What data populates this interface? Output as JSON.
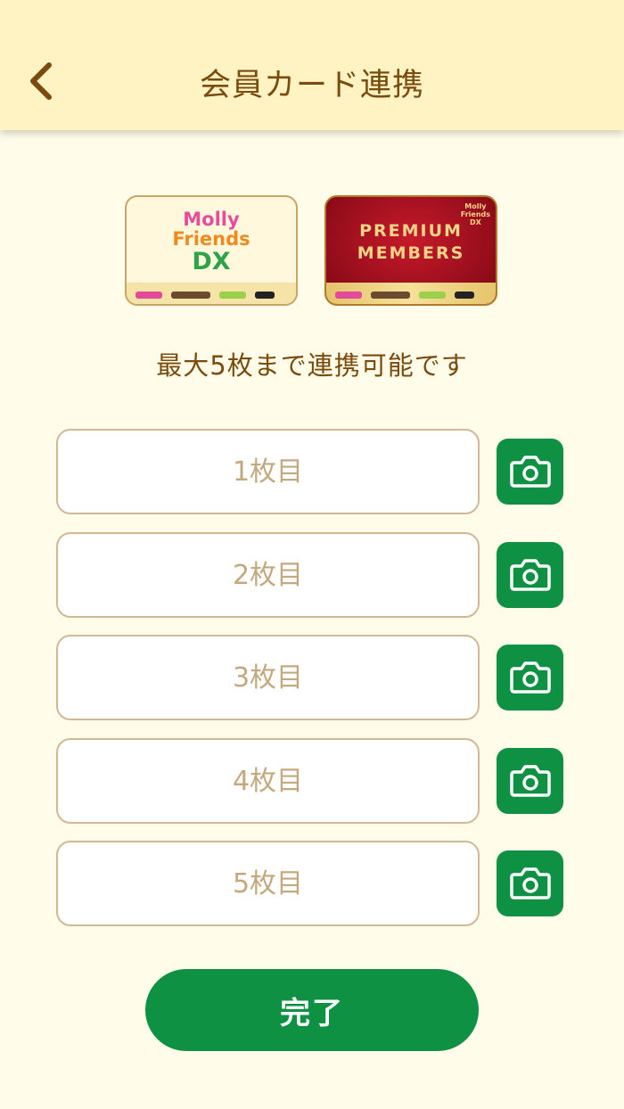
{
  "header": {
    "title": "会員カード連携",
    "back_icon": "chevron-left-icon"
  },
  "cards": {
    "card1": {
      "logo_lines": [
        "Molly",
        "Friends",
        "DX"
      ]
    },
    "card2": {
      "logo_lines": [
        "PREMIUM",
        "MEMBERS"
      ],
      "brand_lines": [
        "Molly",
        "Friends",
        "DX"
      ]
    }
  },
  "note": "最大5枚まで連携可能です",
  "fields": [
    {
      "placeholder": "1枚目",
      "value": ""
    },
    {
      "placeholder": "2枚目",
      "value": ""
    },
    {
      "placeholder": "3枚目",
      "value": ""
    },
    {
      "placeholder": "4枚目",
      "value": ""
    },
    {
      "placeholder": "5枚目",
      "value": ""
    }
  ],
  "camera_icon": "camera-icon",
  "done_label": "完了",
  "colors": {
    "header_bg": "#fff3c4",
    "brown": "#7a4b0c",
    "green": "#0e9142",
    "field_border": "#d2b894",
    "page_bg": "#fffcea"
  }
}
